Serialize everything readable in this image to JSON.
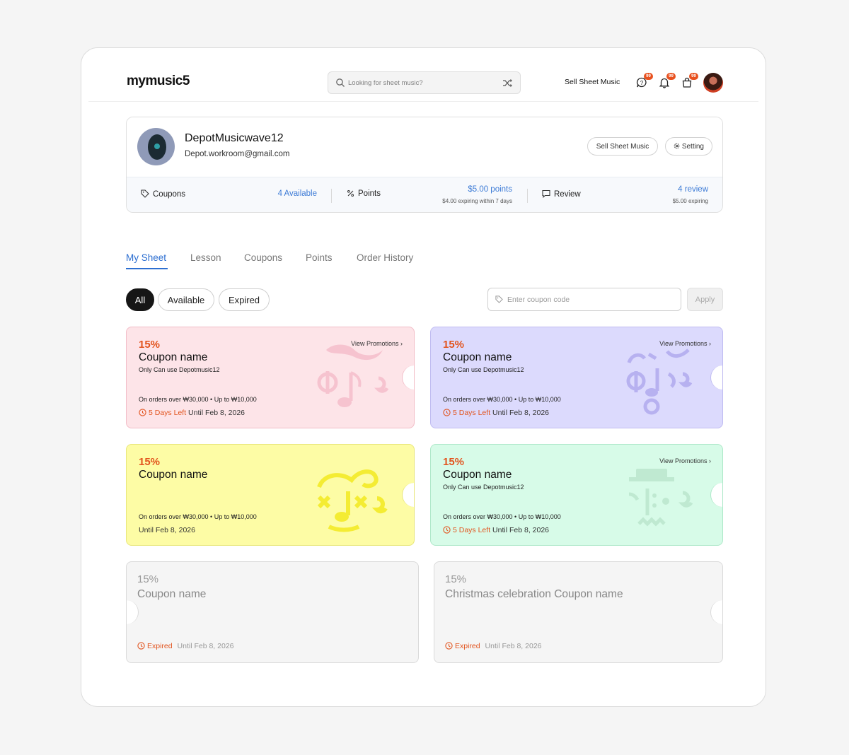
{
  "header": {
    "logo": "mymusic5",
    "search_placeholder": "Looking for sheet music?",
    "sell_link": "Sell Sheet Music",
    "icons": [
      {
        "name": "help-chat-icon",
        "badge": "99"
      },
      {
        "name": "bell-icon",
        "badge": "99"
      },
      {
        "name": "cart-icon",
        "badge": "99"
      }
    ]
  },
  "profile": {
    "name": "DepotMusicwave12",
    "email": "Depot.workroom@gmail.com",
    "sell_button": "Sell Sheet Music",
    "setting_button": "Setting",
    "stats": {
      "coupons": {
        "label": "Coupons",
        "value": "4 Available"
      },
      "points": {
        "label": "Points",
        "value": "$5.00 points",
        "sub": "$4.00 expiring within 7 days"
      },
      "review": {
        "label": "Review",
        "value": "4 review",
        "sub": "$5.00 expiring"
      }
    }
  },
  "tabs": [
    "My Sheet",
    "Lesson",
    "Coupons",
    "Points",
    "Order History"
  ],
  "active_tab": "My Sheet",
  "filters": {
    "chips": [
      "All",
      "Available",
      "Expired"
    ],
    "active": "All",
    "coupon_placeholder": "Enter coupon code",
    "apply_label": "Apply"
  },
  "colors": {
    "accent": "#2d6fd1",
    "warning": "#e2541e",
    "pink": "#fde4e8",
    "lavender": "#dcdafd",
    "yellow": "#fdfca5",
    "mint": "#d7fbe8"
  },
  "coupons": [
    {
      "percent": "15%",
      "name": "Coupon name",
      "restriction": "Only Can use Depotmusic12",
      "conditions": "On orders over ₩30,000 • Up to ₩10,000",
      "days_left": "5 Days Left",
      "until": "Until Feb 8, 2026",
      "promo": "View Promotions"
    },
    {
      "percent": "15%",
      "name": "Coupon name",
      "restriction": "Only Can use Depotmusic12",
      "conditions": "On orders over ₩30,000 • Up to ₩10,000",
      "days_left": "5 Days Left",
      "until": "Until Feb 8, 2026",
      "promo": "View Promotions"
    },
    {
      "percent": "15%",
      "name": "Coupon name",
      "conditions": "On orders over ₩30,000 • Up to ₩10,000",
      "until": "Until Feb 8, 2026"
    },
    {
      "percent": "15%",
      "name": "Coupon name",
      "restriction": "Only Can use Depotmusic12",
      "conditions": "On orders over ₩30,000 • Up to ₩10,000",
      "days_left": "5 Days Left",
      "until": "Until Feb 8, 2026",
      "promo": "View Promotions"
    },
    {
      "percent": "15%",
      "name": "Coupon name",
      "status": "Expired",
      "until": "Until Feb 8, 2026"
    },
    {
      "percent": "15%",
      "name": "Christmas celebration Coupon name",
      "status": "Expired",
      "until": "Until Feb 8, 2026"
    }
  ]
}
